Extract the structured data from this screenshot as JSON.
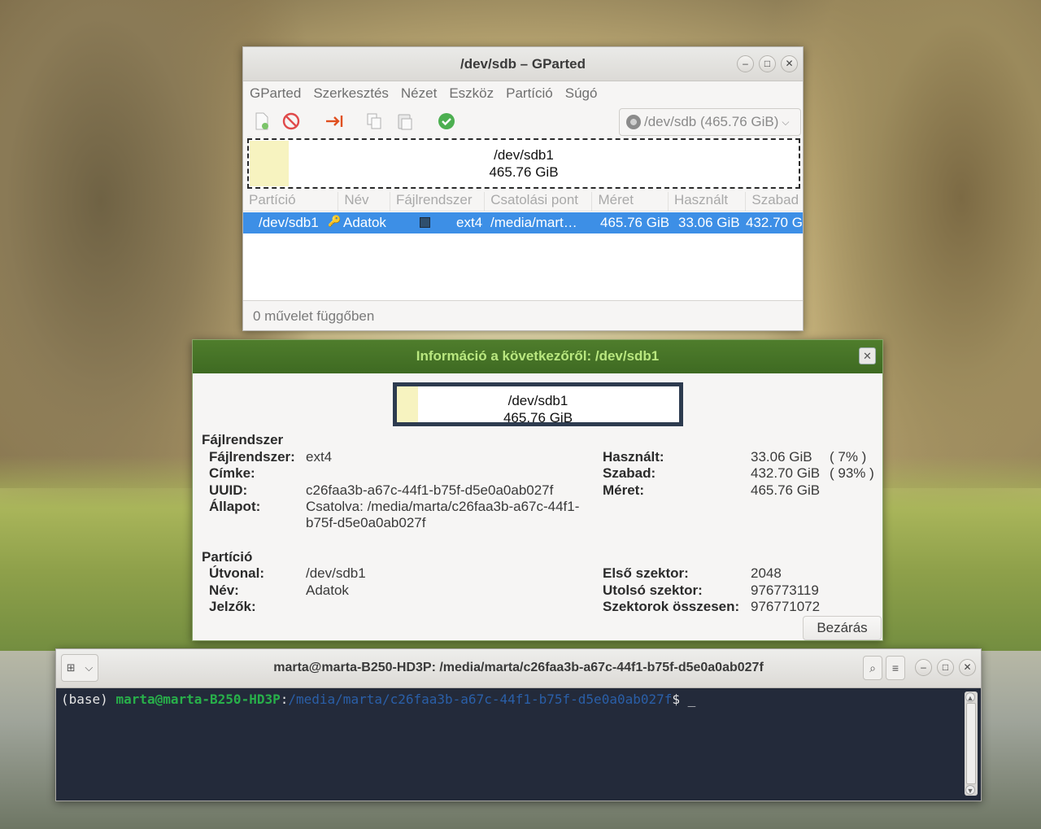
{
  "gparted": {
    "title": "/dev/sdb – GParted",
    "window_controls": {
      "minimize": "–",
      "maximize": "□",
      "close": "✕"
    },
    "menu": [
      "GParted",
      "Szerkesztés",
      "Nézet",
      "Eszköz",
      "Partíció",
      "Súgó"
    ],
    "device_select": "/dev/sdb (465.76 GiB)",
    "partition_map": {
      "name": "/dev/sdb1",
      "size": "465.76 GiB"
    },
    "columns": [
      "Partíció",
      "Név",
      "Fájlrendszer",
      "Csatolási pont",
      "Méret",
      "Használt",
      "Szabad"
    ],
    "row": {
      "partition": "/dev/sdb1",
      "name": "Adatok",
      "filesystem": "ext4",
      "mount_point": "/media/mart…",
      "size": "465.76 GiB",
      "used": "33.06 GiB",
      "free": "432.70 G"
    },
    "status": "0 művelet függőben",
    "colors": {
      "selection": "#3d8fe6",
      "partition_fill": "#f7f3c0",
      "ext4": "#2f4f6d"
    }
  },
  "info": {
    "title": "Információ a következőről: /dev/sdb1",
    "map": {
      "name": "/dev/sdb1",
      "size": "465.76 GiB"
    },
    "filesystem_section": "Fájlrendszer",
    "fs_labels": {
      "filesystem": "Fájlrendszer:",
      "label": "Címke:",
      "uuid": "UUID:",
      "state": "Állapot:"
    },
    "fs_values": {
      "filesystem": "ext4",
      "label": "",
      "uuid": "c26faa3b-a67c-44f1-b75f-d5e0a0ab027f",
      "state_line1": "Csatolva: /media/marta/c26faa3b-a67c-44f1-",
      "state_line2": "b75f-d5e0a0ab027f"
    },
    "usage_labels": {
      "used": "Használt:",
      "free": "Szabad:",
      "size": "Méret:"
    },
    "usage_values": {
      "used": "33.06 GiB",
      "used_pct": "( 7% )",
      "free": "432.70 GiB",
      "free_pct": "( 93% )",
      "size": "465.76 GiB"
    },
    "partition_section": "Partíció",
    "part_labels": {
      "path": "Útvonal:",
      "name": "Név:",
      "flags": "Jelzők:"
    },
    "part_values": {
      "path": "/dev/sdb1",
      "name": "Adatok",
      "flags": ""
    },
    "sector_labels": {
      "first": "Első szektor:",
      "last": "Utolsó szektor:",
      "total": "Szektorok összesen:"
    },
    "sector_values": {
      "first": "2048",
      "last": "976773119",
      "total": "976771072"
    },
    "close_button": "Bezárás",
    "colors": {
      "titlebar": "#4a7a28",
      "title_text": "#b9e77f"
    }
  },
  "terminal": {
    "title": "marta@marta-B250-HD3P: /media/marta/c26faa3b-a67c-44f1-b75f-d5e0a0ab027f",
    "prompt_env": "(base) ",
    "prompt_user": "marta@marta-B250-HD3P",
    "prompt_colon": ":",
    "prompt_path": "/media/marta/c26faa3b-a67c-44f1-b75f-d5e0a0ab027f",
    "prompt_dollar": "$ _",
    "colors": {
      "background": "#232a3a",
      "user": "#28b04a",
      "path": "#2a5fa8"
    }
  }
}
